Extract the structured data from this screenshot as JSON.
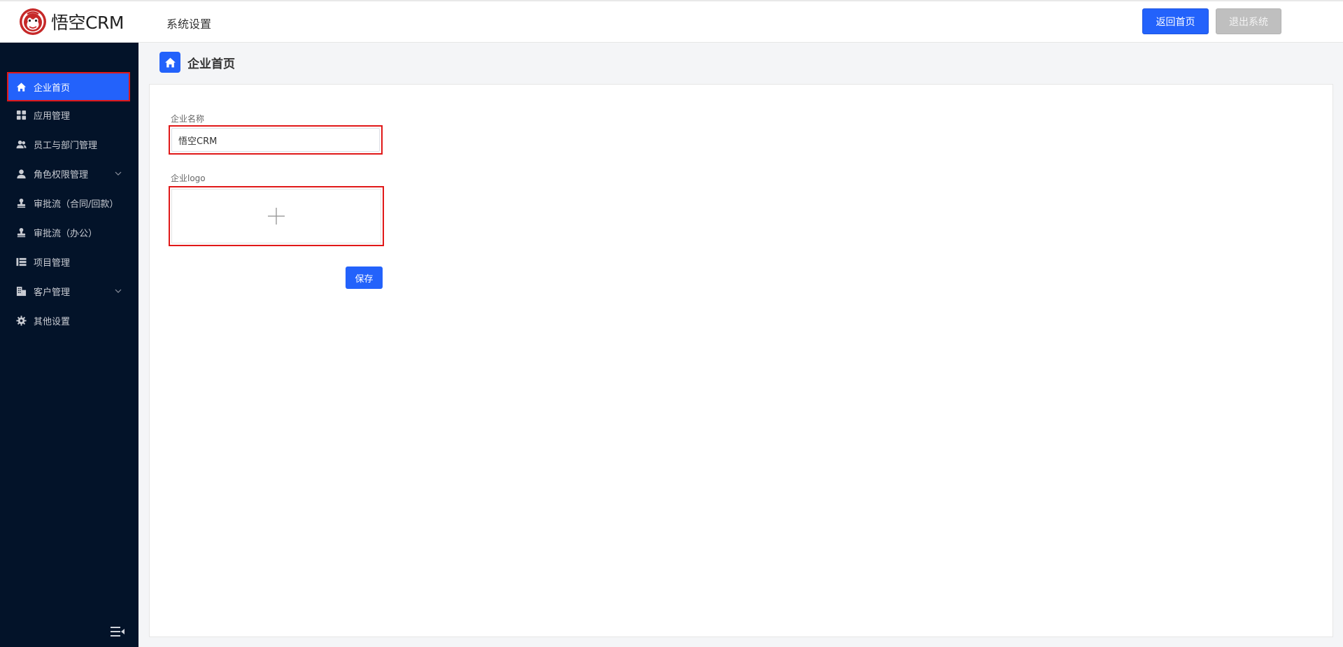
{
  "header": {
    "logo_text": "悟空CRM",
    "title": "系统设置",
    "home_button": "返回首页",
    "exit_button": "退出系统"
  },
  "sidebar": {
    "items": [
      {
        "label": "企业首页",
        "icon": "home-icon",
        "active": true
      },
      {
        "label": "应用管理",
        "icon": "grid-icon"
      },
      {
        "label": "员工与部门管理",
        "icon": "users-icon"
      },
      {
        "label": "角色权限管理",
        "icon": "user-icon",
        "expandable": true
      },
      {
        "label": "审批流（合同/回款）",
        "icon": "stamp-icon"
      },
      {
        "label": "审批流（办公）",
        "icon": "stamp-icon"
      },
      {
        "label": "项目管理",
        "icon": "project-icon"
      },
      {
        "label": "客户管理",
        "icon": "building-icon",
        "expandable": true
      },
      {
        "label": "其他设置",
        "icon": "gear-icon"
      }
    ]
  },
  "main": {
    "page_title": "企业首页",
    "company_name_label": "企业名称",
    "company_name_value": "悟空CRM",
    "logo_label": "企业logo",
    "save_button": "保存"
  },
  "colors": {
    "primary": "#2362fb",
    "sidebar_bg": "#031329",
    "highlight_border": "#e01818"
  }
}
